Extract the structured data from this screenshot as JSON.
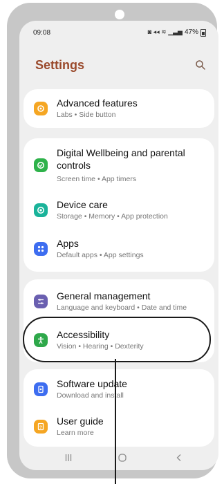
{
  "status_bar": {
    "time": "09:08",
    "battery": "47%"
  },
  "header": {
    "title": "Settings"
  },
  "items": [
    {
      "title": "Advanced features",
      "subtitle": "Labs • Side button",
      "icon": "star-gear-icon",
      "color": "#f5a623"
    },
    {
      "title": "Digital Wellbeing and parental controls",
      "subtitle": "Screen time • App timers",
      "icon": "wellbeing-icon",
      "color": "#2eb24a"
    },
    {
      "title": "Device care",
      "subtitle": "Storage • Memory • App protection",
      "icon": "device-care-icon",
      "color": "#1ab39a"
    },
    {
      "title": "Apps",
      "subtitle": "Default apps • App settings",
      "icon": "apps-grid-icon",
      "color": "#3d6df0"
    },
    {
      "title": "General management",
      "subtitle": "Language and keyboard • Date and time",
      "icon": "sliders-icon",
      "color": "#6a5fb0"
    },
    {
      "title": "Accessibility",
      "subtitle": "Vision • Hearing • Dexterity",
      "icon": "accessibility-icon",
      "color": "#2ea84a"
    },
    {
      "title": "Software update",
      "subtitle": "Download and install",
      "icon": "software-update-icon",
      "color": "#3d6df0"
    },
    {
      "title": "User guide",
      "subtitle": "Learn more",
      "icon": "user-guide-icon",
      "color": "#f5a623"
    }
  ]
}
